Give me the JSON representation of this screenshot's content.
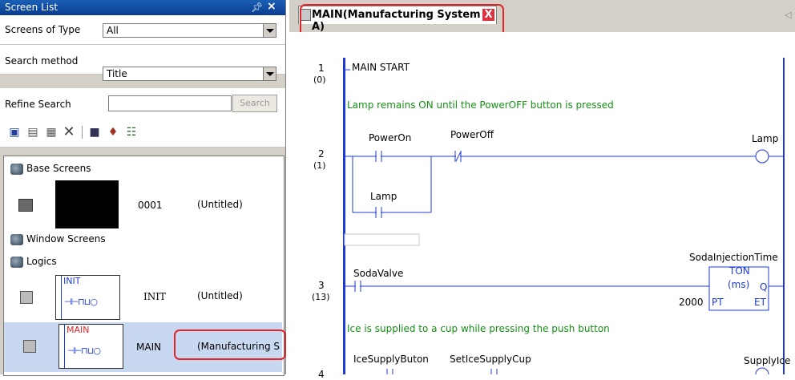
{
  "screen_list": {
    "title": "Screen List",
    "pin_icon": "pin-icon",
    "close_icon": "close-icon",
    "screens_of_type_label": "Screens of Type",
    "screens_of_type_value": "All",
    "search_method_label": "Search method",
    "search_method_value": "Title",
    "refine_search_label": "Refine Search",
    "refine_search_value": "",
    "search_button": "Search",
    "toolbar_icons": [
      "new-screen-icon",
      "copy-screen-icon",
      "paste-screen-icon",
      "delete-icon",
      "open-screen-icon",
      "screen-properties-icon",
      "logic-icon"
    ],
    "categories": {
      "base": "Base Screens",
      "window": "Window Screens",
      "logics": "Logics"
    },
    "base_item": {
      "number": "0001",
      "title": "(Untitled)"
    },
    "logic_items": [
      {
        "thumb_label": "INIT",
        "name": "INIT",
        "title": "(Untitled)"
      },
      {
        "thumb_label": "MAIN",
        "name": "MAIN",
        "title": "(Manufacturing S"
      }
    ]
  },
  "editor": {
    "tab_title": "MAIN(Manufacturing System A)",
    "tab_close": "X",
    "rungs": [
      {
        "num": "1",
        "sub": "(0)",
        "label": "MAIN START"
      },
      {
        "num": "2",
        "sub": "(1)"
      },
      {
        "num": "3",
        "sub": "(13)"
      },
      {
        "num": "4",
        "sub": ""
      }
    ],
    "comments": [
      "Lamp remains ON until the  PowerOFF button is pressed",
      "Ice is supplied to a cup while pressing the push button"
    ],
    "contacts": {
      "power_on": "PowerOn",
      "power_off": "PowerOff",
      "lamp_contact": "Lamp",
      "lamp_coil": "Lamp",
      "soda_valve": "SodaValve",
      "ice_supply_button": "IceSupplyButon",
      "set_ice_supply_cup": "SetIceSupplyCup",
      "supply_ice": "SupplyIce"
    },
    "timer": {
      "name": "SodaInjectionTime",
      "type": "TON",
      "unit": "(ms)",
      "q": "Q",
      "pt": "PT",
      "et": "ET",
      "preset": "2000"
    }
  }
}
